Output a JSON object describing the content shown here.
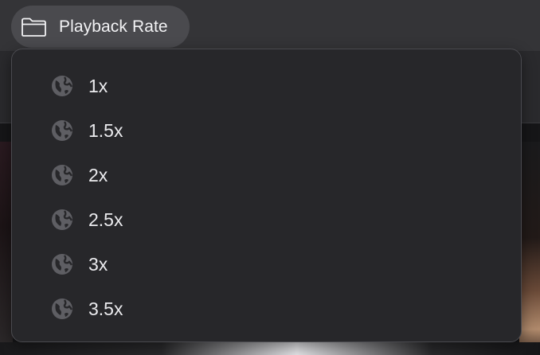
{
  "folder": {
    "label": "Playback Rate",
    "icon": "folder-icon"
  },
  "menu": {
    "items": [
      {
        "label": "1x",
        "icon": "globe-icon"
      },
      {
        "label": "1.5x",
        "icon": "globe-icon"
      },
      {
        "label": "2x",
        "icon": "globe-icon"
      },
      {
        "label": "2.5x",
        "icon": "globe-icon"
      },
      {
        "label": "3x",
        "icon": "globe-icon"
      },
      {
        "label": "3.5x",
        "icon": "globe-icon"
      }
    ]
  },
  "colors": {
    "menu_background": "#27272a",
    "chip_background": "#4a4a4e",
    "icon_gray": "#5e5e63",
    "text": "#ebebee"
  }
}
